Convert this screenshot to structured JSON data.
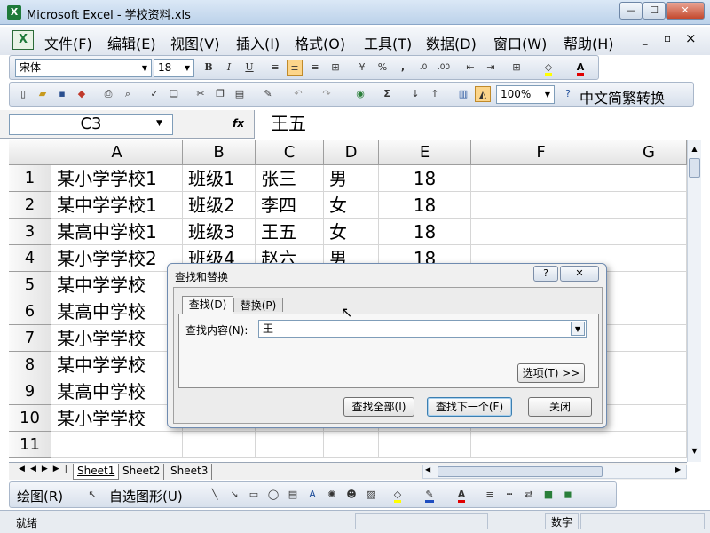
{
  "window": {
    "title": "Microsoft Excel - 学校资料.xls",
    "app_icon": "X",
    "minimize_label": "—",
    "maximize_label": "☐",
    "close_label": "✕"
  },
  "menubar": {
    "items": [
      "文件(F)",
      "编辑(E)",
      "视图(V)",
      "插入(I)",
      "格式(O)",
      "工具(T)",
      "数据(D)",
      "窗口(W)",
      "帮助(H)"
    ],
    "restore_label": "▫",
    "close_label": "×"
  },
  "formatting_toolbar": {
    "font_name": "宋体",
    "font_size": "18",
    "bold": "B",
    "italic": "I",
    "underline": "U",
    "percent": "%",
    "comma": ","
  },
  "standard_toolbar": {
    "zoom": "100%",
    "convert_label": "中文简繁转换"
  },
  "formula_bar": {
    "name_box": "C3",
    "fx": "fx",
    "value": "王五"
  },
  "sheet": {
    "columns": [
      "A",
      "B",
      "C",
      "D",
      "E",
      "F",
      "G"
    ],
    "rows": [
      {
        "num": "1",
        "cells": [
          "某小学学校1",
          "班级1",
          "张三",
          "男",
          "18"
        ]
      },
      {
        "num": "2",
        "cells": [
          "某中学学校1",
          "班级2",
          "李四",
          "女",
          "18"
        ]
      },
      {
        "num": "3",
        "cells": [
          "某高中学校1",
          "班级3",
          "王五",
          "女",
          "18"
        ]
      },
      {
        "num": "4",
        "cells": [
          "某小学学校2",
          "班级4",
          "赵六",
          "男",
          "18"
        ]
      },
      {
        "num": "5",
        "cells": [
          "某中学学校",
          "",
          "",
          "",
          ""
        ]
      },
      {
        "num": "6",
        "cells": [
          "某高中学校",
          "",
          "",
          "",
          ""
        ]
      },
      {
        "num": "7",
        "cells": [
          "某小学学校",
          "",
          "",
          "",
          ""
        ]
      },
      {
        "num": "8",
        "cells": [
          "某中学学校",
          "",
          "",
          "",
          ""
        ]
      },
      {
        "num": "9",
        "cells": [
          "某高中学校",
          "",
          "",
          "",
          ""
        ]
      },
      {
        "num": "10",
        "cells": [
          "某小学学校",
          "",
          "",
          "",
          ""
        ]
      },
      {
        "num": "11",
        "cells": [
          "",
          "",
          "",
          "",
          ""
        ]
      }
    ],
    "tabs": [
      "Sheet1",
      "Sheet2",
      "Sheet3"
    ]
  },
  "drawing_toolbar": {
    "draw_label": "绘图(R)",
    "autoshapes_label": "自选图形(U)"
  },
  "statusbar": {
    "left": "就绪",
    "right": "数字"
  },
  "dialog": {
    "title": "查找和替换",
    "help_label": "?",
    "close_label": "✕",
    "tabs": [
      "查找(D)",
      "替换(P)"
    ],
    "find_label": "查找内容(N):",
    "find_value": "王",
    "options_label": "选项(T) >>",
    "find_all_label": "查找全部(I)",
    "find_next_label": "查找下一个(F)",
    "close_button_label": "关闭"
  }
}
